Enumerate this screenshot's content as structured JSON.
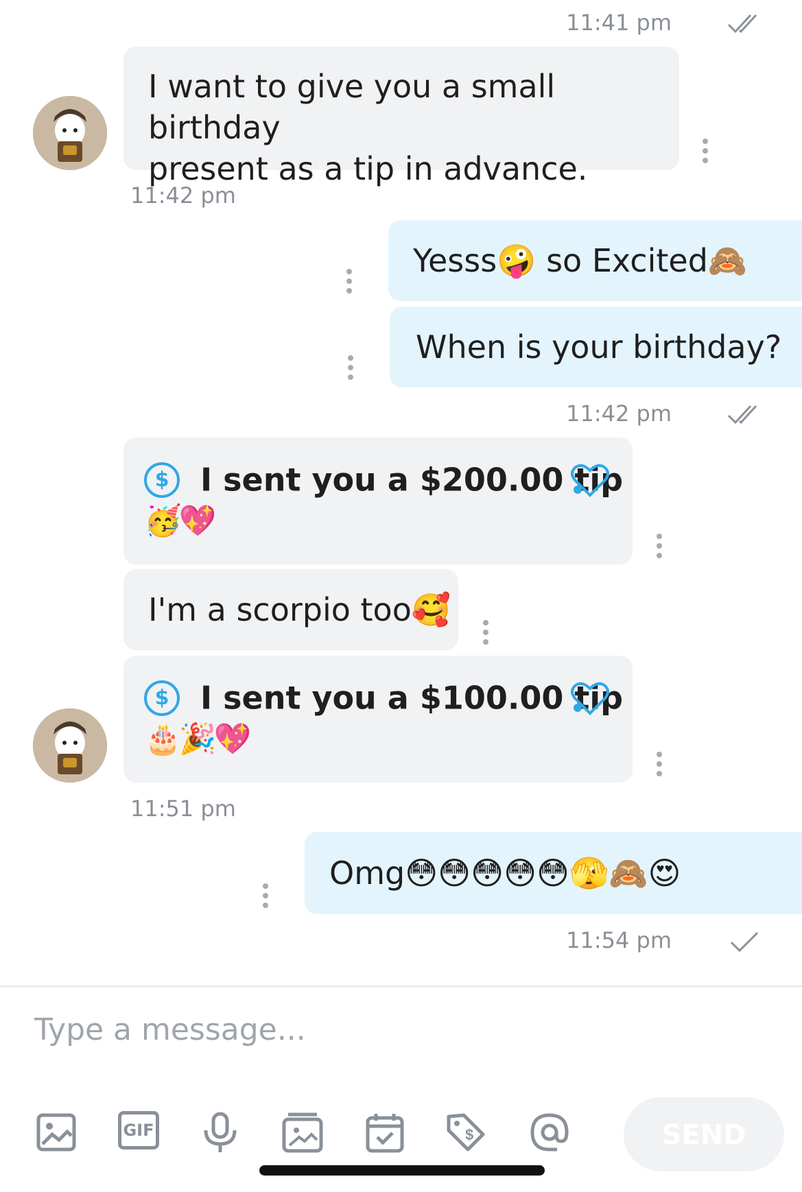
{
  "messages": {
    "m1": {
      "time": "11:41 pm",
      "text_line1": "I want to give you a small birthday",
      "text_line2": "present as a tip in advance.",
      "below_time": "11:42 pm"
    },
    "m2": {
      "text": "Yesss🤪 so Excited🙈"
    },
    "m3": {
      "text": "When is your birthday?",
      "time": "11:42 pm"
    },
    "m4": {
      "tip_text": "I sent you a $200.00 tip",
      "emojis": "🥳💖"
    },
    "m5": {
      "text": "I'm a scorpio too🥰"
    },
    "m6": {
      "tip_text": "I sent you a $100.00 tip",
      "emojis": "🎂🎉💖",
      "below_time": "11:51 pm"
    },
    "m7": {
      "text": "Omg😳😳😳😳😳🫣🙈😍",
      "time": "11:54 pm"
    }
  },
  "tip_symbol": "$",
  "composer": {
    "placeholder": "Type a message...",
    "send_label": "SEND",
    "gif_label": "GIF"
  },
  "colors": {
    "incoming_bubble": "#f1f2f4",
    "outgoing_bubble": "#e3f4fd",
    "accent": "#2fa8e6",
    "icon_gray": "#8a9099"
  }
}
